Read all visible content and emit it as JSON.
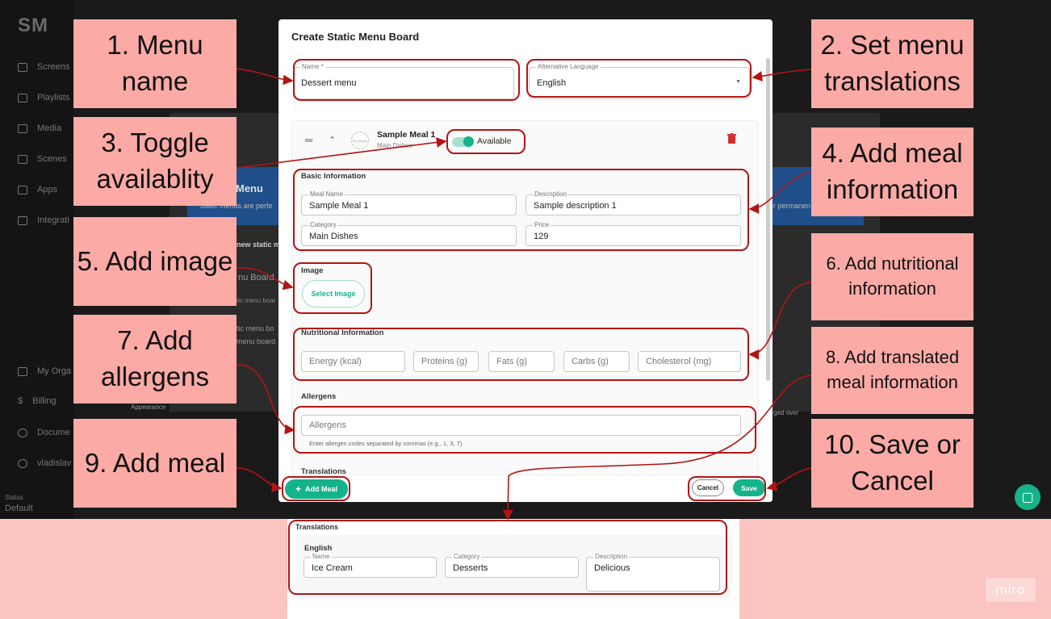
{
  "background_app": {
    "logo": "SM",
    "nav_items": [
      "Screens",
      "Playlists",
      "Media",
      "Scenes",
      "Apps",
      "Integrati"
    ],
    "bottom_items": [
      "My Orga",
      "Billing",
      "Docume",
      "vladislav"
    ],
    "status_label": "Status",
    "status_value": "Default",
    "bg_texts": {
      "menu_heading": "Menu",
      "static_desc": "Static menus are perfe",
      "new_static": "new static m",
      "menu_board": "nu Board",
      "tic_board": "tic menu boar",
      "tic_board2": "tic menu bo",
      "menu_board2": "menu board",
      "appearance": "Appearance",
      "permanent": "r permanen",
      "ged_over": "ged over"
    }
  },
  "modal": {
    "title": "Create Static Menu Board",
    "name_field": {
      "label": "Name *",
      "value": "Dessert menu"
    },
    "alt_language": {
      "label": "Alternative Language",
      "value": "English"
    },
    "meal": {
      "title": "Sample Meal 1",
      "subtitle": "Main Dishes",
      "no_image": "No Image",
      "availability_label": "Available",
      "basic_info_title": "Basic Information",
      "meal_name": {
        "label": "Meal Name",
        "value": "Sample Meal 1"
      },
      "description": {
        "label": "Description",
        "value": "Sample description 1"
      },
      "category": {
        "label": "Category",
        "value": "Main Dishes"
      },
      "price": {
        "label": "Price",
        "value": "129"
      },
      "image_title": "Image",
      "select_image": "Select Image",
      "nutrition_title": "Nutritional Information",
      "nutrition_fields": [
        "Energy (kcal)",
        "Proteins (g)",
        "Fats (g)",
        "Carbs (g)",
        "Cholesterol (mg)"
      ],
      "allergens_title": "Allergens",
      "allergens_placeholder": "Allergens",
      "allergens_hint": "Enter allergen codes separated by commas (e.g., 1, 3, 7)",
      "translations_title": "Translations"
    },
    "add_meal": "Add Meal",
    "cancel": "Cancel",
    "save": "Save"
  },
  "translations_panel": {
    "title": "Translations",
    "language": "English",
    "name": {
      "label": "Name",
      "value": "Ice Cream"
    },
    "category": {
      "label": "Category",
      "value": "Desserts"
    },
    "description": {
      "label": "Description",
      "value": "Delicious"
    }
  },
  "callouts": {
    "c1": "1. Menu name",
    "c2": "2. Set menu translations",
    "c3": "3. Toggle availablity",
    "c4": "4. Add meal information",
    "c5": "5. Add image",
    "c6": "6. Add nutritional information",
    "c7": "7. Add allergens",
    "c8": "8. Add translated meal information",
    "c9": "9. Add meal",
    "c10": "10. Save or Cancel"
  },
  "watermark": "miro",
  "colors": {
    "accent": "#14b38a",
    "callout": "#fbaaa6",
    "highlight": "#b41414",
    "delete": "#d32f2f"
  }
}
